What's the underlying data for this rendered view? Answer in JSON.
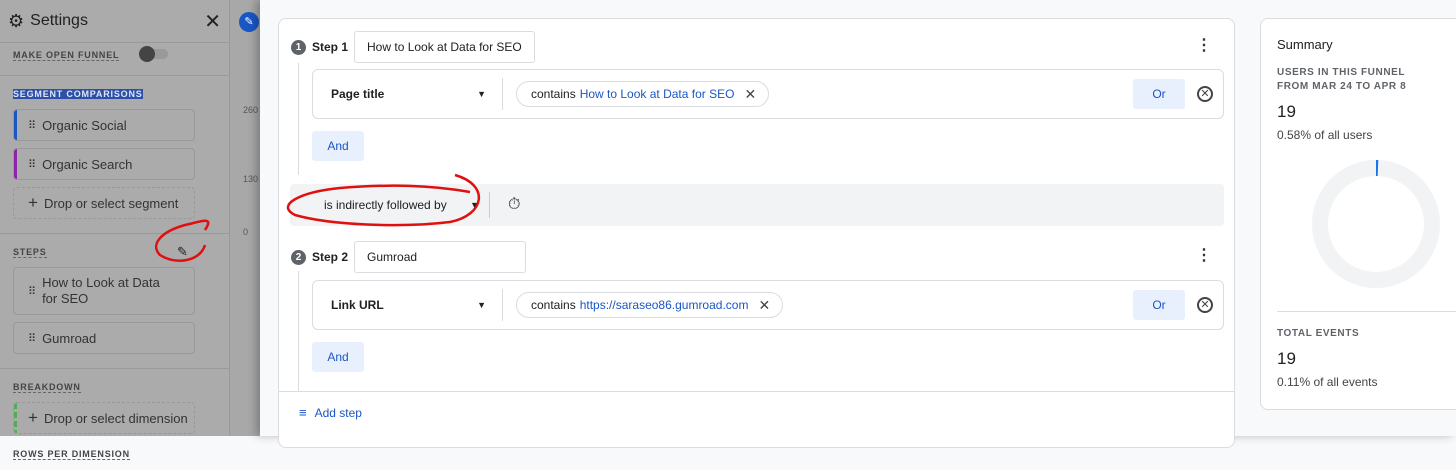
{
  "sidebar": {
    "title": "Settings",
    "open_funnel": "MAKE OPEN FUNNEL",
    "segment_comparisons": "SEGMENT COMPARISONS",
    "segments": [
      {
        "label": "Organic Social",
        "color": "#1a56c4"
      },
      {
        "label": "Organic Search",
        "color": "#8e24aa"
      }
    ],
    "drop_segment": "Drop or select segment",
    "steps_label": "STEPS",
    "steps": [
      "How to Look at Data for SEO",
      "Gumroad"
    ],
    "breakdown": "BREAKDOWN",
    "drop_dimension": "Drop or select dimension",
    "rows_per_dimension": "ROWS PER DIMENSION"
  },
  "background_chart": {
    "ticks": [
      "260",
      "130",
      "0"
    ]
  },
  "steps": [
    {
      "label": "Step 1",
      "number": "1",
      "name": "How to Look at Data for SEO",
      "dimension": "Page title",
      "operator": "contains",
      "value": "How to Look at Data for SEO",
      "or": "Or",
      "and": "And"
    },
    {
      "label": "Step 2",
      "number": "2",
      "name": "Gumroad",
      "dimension": "Link URL",
      "operator": "contains",
      "value": "https://saraseo86.gumroad.com",
      "or": "Or",
      "and": "And"
    }
  ],
  "sequence": "is indirectly followed by",
  "add_step": "Add step",
  "summary": {
    "title": "Summary",
    "users_label_1": "USERS IN THIS FUNNEL",
    "users_label_2": "FROM MAR 24 TO APR 8",
    "users": "19",
    "users_pct": "0.58% of all users",
    "users_fraction": 0.0058,
    "events_label": "TOTAL EVENTS",
    "events": "19",
    "events_pct": "0.11% of all events",
    "accent": "#1a73e8"
  }
}
